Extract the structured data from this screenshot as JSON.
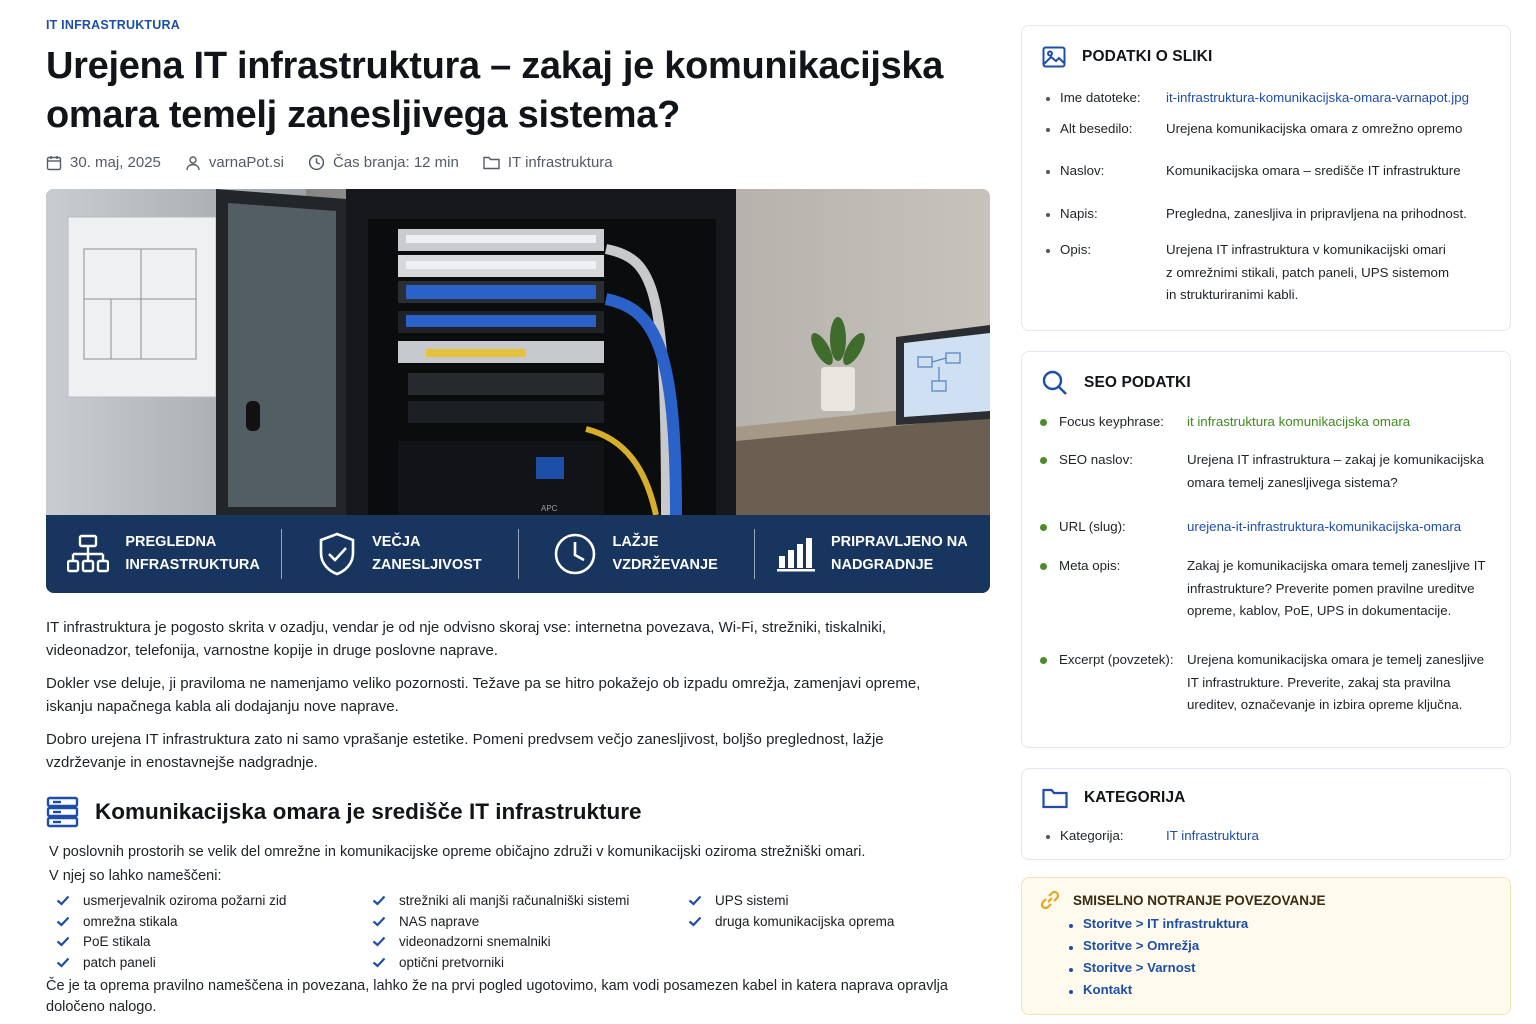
{
  "article": {
    "category_label": "IT INFRASTRUKTURA",
    "title": "Urejena IT infrastruktura – zakaj je komunikacijska omara temelj zanesljivega sistema?",
    "meta": {
      "date": "30. maj, 2025",
      "author": "varnaPot.si",
      "read_time": "Čas branja: 12 min",
      "category": "IT infrastruktura"
    },
    "hero_features": [
      {
        "icon": "network-hierarchy-icon",
        "label": "PREGLEDNA\nINFRASTRUKTURA"
      },
      {
        "icon": "shield-check-icon",
        "label": "VEČJA\nZANESLJIVOST"
      },
      {
        "icon": "clock-icon",
        "label": "LAŽJE\nVZDRŽEVANJE"
      },
      {
        "icon": "bar-chart-icon",
        "label": "PRIPRAVLJENO NA\nNADGRADNJE"
      }
    ],
    "hero_ups_label": "APC",
    "intro": [
      "IT infrastruktura je pogosto skrita v ozadju, vendar je od nje odvisno skoraj vse: internetna povezava, Wi-Fi, strežniki, tiskalniki, videonadzor, telefonija, varnostne kopije in druge poslovne naprave.",
      "Dokler vse deluje, ji praviloma ne namenjamo veliko pozornosti. Težave pa se hitro pokažejo ob izpadu omrežja, zamenjavi opreme, iskanju napačnega kabla ali dodajanju nove naprave.",
      "Dobro urejena IT infrastruktura zato ni samo vprašanje estetike. Pomeni predvsem večjo zanesljivost, boljšo preglednost, lažje vzdrževanje in enostavnejše nadgradnje."
    ],
    "section": {
      "heading": "Komunikacijska omara je središče IT infrastrukture",
      "lead_1": "V poslovnih prostorih se velik del omrežne in komunikacijske opreme običajno združi v komunikacijski oziroma strežniški omari.",
      "lead_2": "V njej so lahko nameščeni:",
      "items": [
        "usmerjevalnik oziroma požarni zid",
        "strežniki ali manjši računalniški sistemi",
        "UPS sistemi",
        "omrežna stikala",
        "NAS naprave",
        "druga komunikacijska oprema",
        "PoE stikala",
        "videonadzorni snemalniki",
        "",
        "patch paneli",
        "optični pretvorniki",
        ""
      ],
      "closing": "Če je ta oprema pravilno nameščena in povezana, lahko že na prvi pogled ugotovimo, kam vodi posamezen kabel in katera naprava opravlja določeno nalogo."
    }
  },
  "sidebar": {
    "image_info": {
      "title": "PODATKI O SLIKI",
      "rows": [
        {
          "label": "Ime datoteke:",
          "value": "it-infrastruktura-komunikacijska-omara-varnapot.jpg"
        },
        {
          "label": "Alt besedilo:",
          "value": "Urejena komunikacijska omara z omrežno opremo"
        },
        {
          "label": "Naslov:",
          "value": "Komunikacijska omara – središče IT infrastrukture"
        },
        {
          "label": "Napis:",
          "value": "Pregledna, zanesljiva in pripravljena na prihodnost."
        },
        {
          "label": "Opis:",
          "value": "Urejena IT infrastruktura v komunikacijski omari\nz omrežnimi stikali, patch paneli, UPS sistemom\nin strukturiranimi kabli."
        }
      ]
    },
    "seo": {
      "title": "SEO PODATKI",
      "rows": [
        {
          "label": "Focus keyphrase:",
          "value": "it infrastruktura komunikacijska omara"
        },
        {
          "label": "SEO naslov:",
          "value": "Urejena IT infrastruktura – zakaj je komunikacijska\nomara temelj zanesljivega sistema?"
        },
        {
          "label": "URL (slug):",
          "value": "urejena-it-infrastruktura-komunikacijska-omara"
        },
        {
          "label": "Meta opis:",
          "value": "Zakaj je komunikacijska omara temelj zanesljive IT\ninfrastrukture? Preverite pomen pravilne ureditve\nopreme, kablov, PoE, UPS in dokumentacije."
        },
        {
          "label": "Excerpt (povzetek):",
          "value": "Urejena komunikacijska omara je temelj zanesljive\nIT infrastrukture. Preverite, zakaj sta pravilna\nureditev, označevanje in izbira opreme ključna."
        }
      ]
    },
    "category": {
      "title": "KATEGORIJA",
      "label": "Kategorija:",
      "value": "IT infrastruktura"
    },
    "internal_links": {
      "title": "SMISELNO NOTRANJE POVEZOVANJE",
      "links": [
        "Storitve > IT infrastruktura",
        "Storitve > Omrežja",
        "Storitve > Varnost",
        "Kontakt"
      ]
    }
  },
  "colors": {
    "accent_blue": "#1d4fa8",
    "hero_strip": "#17355e",
    "seo_green": "#3f8a1f",
    "link_box_bg": "#fffaee",
    "link_icon": "#e0a820"
  }
}
